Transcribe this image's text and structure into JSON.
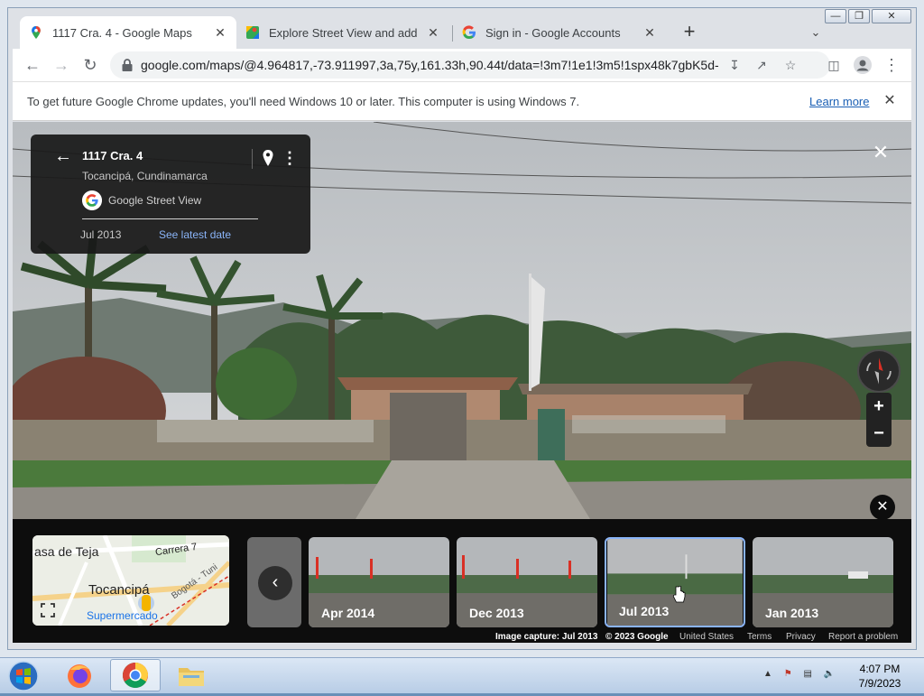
{
  "browser": {
    "tabs": [
      {
        "title": "1117 Cra. 4 - Google Maps",
        "active": true
      },
      {
        "title": "Explore Street View and add your",
        "active": false
      },
      {
        "title": "Sign in - Google Accounts",
        "active": false
      }
    ],
    "new_tab": "+",
    "url": "google.com/maps/@4.964817,-73.911997,3a,75y,161.33h,90.44t/data=!3m7!1e1!3m5!1spx48k7gbK5d-..."
  },
  "infobar": {
    "message": "To get future Google Chrome updates, you'll need Windows 10 or later. This computer is using Windows 7.",
    "link": "Learn more"
  },
  "place_card": {
    "address": "1117 Cra. 4",
    "locality": "Tocancipá, Cundinamarca",
    "source": "Google Street View",
    "capture_date": "Jul 2013",
    "latest_link": "See latest date"
  },
  "minimap": {
    "labels": [
      "asa de Teja",
      "Carrera 7",
      "Tocancipá",
      "Bogotá - Tuni",
      "Supermercado"
    ]
  },
  "timeline": {
    "items": [
      {
        "label": "Apr 2014",
        "selected": false
      },
      {
        "label": "Dec 2013",
        "selected": false
      },
      {
        "label": "Jul 2013",
        "selected": true
      },
      {
        "label": "Jan 2013",
        "selected": false
      }
    ]
  },
  "footer": {
    "capture": "Image capture: Jul 2013",
    "copyright": "© 2023 Google",
    "country": "United States",
    "terms": "Terms",
    "privacy": "Privacy",
    "report": "Report a problem"
  },
  "taskbar": {
    "time": "4:07 PM",
    "date": "7/9/2023"
  },
  "colors": {
    "link": "#8ab4f8",
    "accent_red": "#d93025"
  }
}
